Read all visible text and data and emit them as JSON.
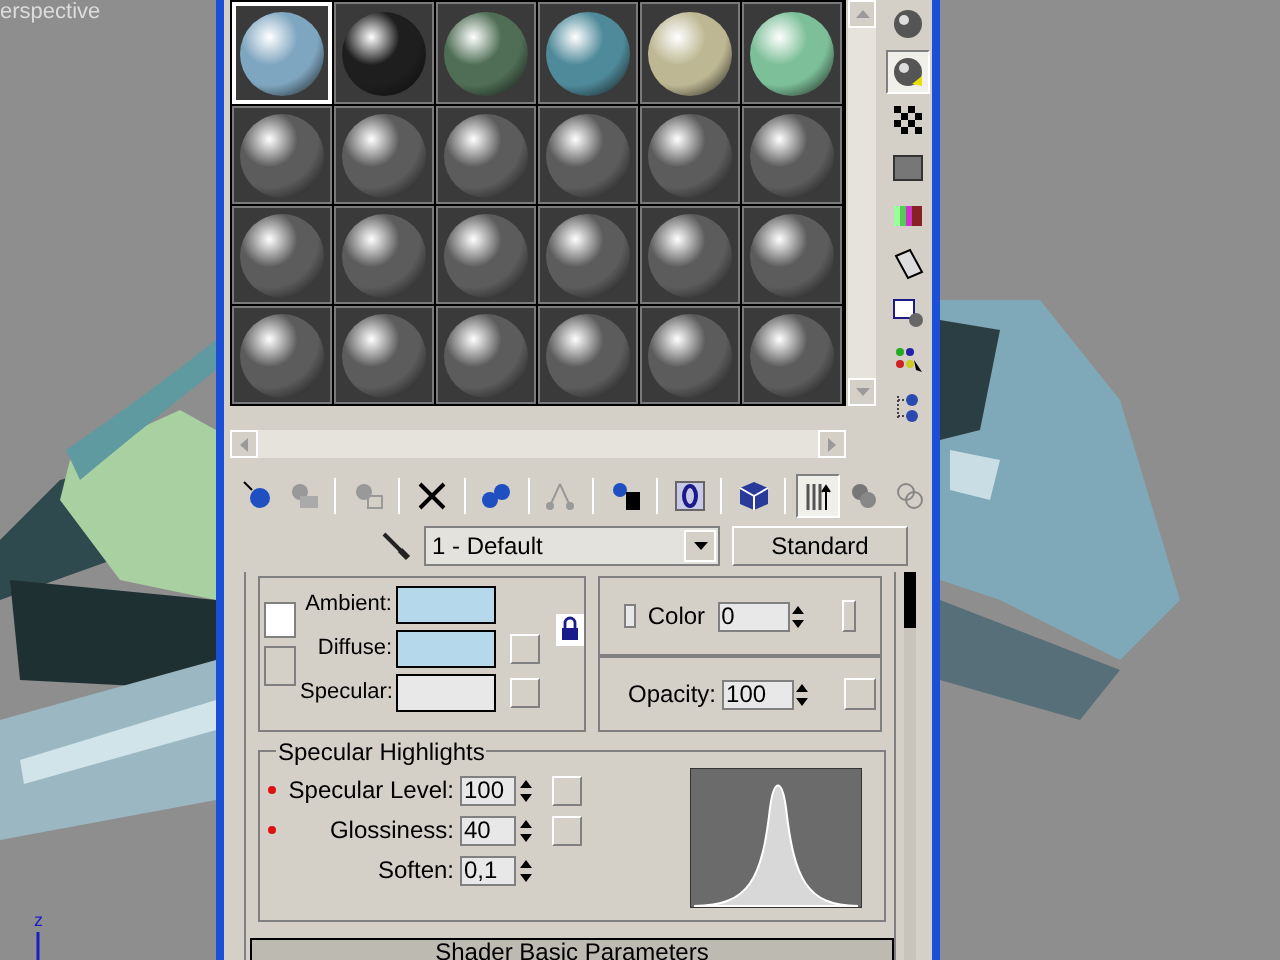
{
  "viewport": {
    "label": "erspective",
    "axis_label": "z"
  },
  "sample_slots": [
    {
      "color": "#7fa6c0",
      "selected": true
    },
    {
      "color": "#1e1e1e",
      "selected": false
    },
    {
      "color": "#4f6e55",
      "selected": false
    },
    {
      "color": "#4f8a9a",
      "selected": false
    },
    {
      "color": "#bdb893",
      "selected": false
    },
    {
      "color": "#7cbf98",
      "selected": false
    },
    {
      "color": "#5c5c5c",
      "selected": false
    },
    {
      "color": "#5c5c5c",
      "selected": false
    },
    {
      "color": "#5c5c5c",
      "selected": false
    },
    {
      "color": "#5c5c5c",
      "selected": false
    },
    {
      "color": "#5c5c5c",
      "selected": false
    },
    {
      "color": "#5c5c5c",
      "selected": false
    },
    {
      "color": "#5c5c5c",
      "selected": false
    },
    {
      "color": "#5c5c5c",
      "selected": false
    },
    {
      "color": "#5c5c5c",
      "selected": false
    },
    {
      "color": "#5c5c5c",
      "selected": false
    },
    {
      "color": "#5c5c5c",
      "selected": false
    },
    {
      "color": "#5c5c5c",
      "selected": false
    },
    {
      "color": "#5c5c5c",
      "selected": false
    },
    {
      "color": "#5c5c5c",
      "selected": false
    },
    {
      "color": "#5c5c5c",
      "selected": false
    },
    {
      "color": "#5c5c5c",
      "selected": false
    },
    {
      "color": "#5c5c5c",
      "selected": false
    },
    {
      "color": "#5c5c5c",
      "selected": false
    }
  ],
  "side_tools": [
    {
      "pressed": false
    },
    {
      "pressed": true
    },
    {
      "pressed": false
    },
    {
      "pressed": false
    },
    {
      "pressed": false
    },
    {
      "pressed": false
    },
    {
      "pressed": false
    },
    {
      "pressed": false
    },
    {
      "pressed": false
    }
  ],
  "toolbar": [
    {
      "pressed": false
    },
    {
      "pressed": false
    },
    {
      "pressed": false
    },
    {
      "pressed": false
    },
    {
      "pressed": false
    },
    {
      "pressed": false
    },
    {
      "pressed": false
    },
    {
      "pressed": false
    },
    {
      "pressed": false
    },
    {
      "pressed": true
    },
    {
      "pressed": false
    },
    {
      "pressed": false
    }
  ],
  "material_name": "1 - Default",
  "material_type": "Standard",
  "basic_params": [
    {
      "label": "Ambient:",
      "color": "#b5d9ea"
    },
    {
      "label": "Diffuse:",
      "color": "#b5d9ea"
    },
    {
      "label": "Specular:",
      "color": "#e8e8e8"
    }
  ],
  "self_illumination": {
    "checked": false,
    "label": "Color",
    "value": "0"
  },
  "opacity": {
    "label": "Opacity:",
    "value": "100"
  },
  "specular_highlights": {
    "title": "Specular Highlights",
    "rows": [
      {
        "label": "Specular Level:",
        "value": "100",
        "animated": true
      },
      {
        "label": "Glossiness:",
        "value": "40",
        "animated": true
      },
      {
        "label": "Soften:",
        "value": "0,1",
        "animated": false
      }
    ]
  },
  "rollout": {
    "title": "Shader Basic Parameters"
  }
}
